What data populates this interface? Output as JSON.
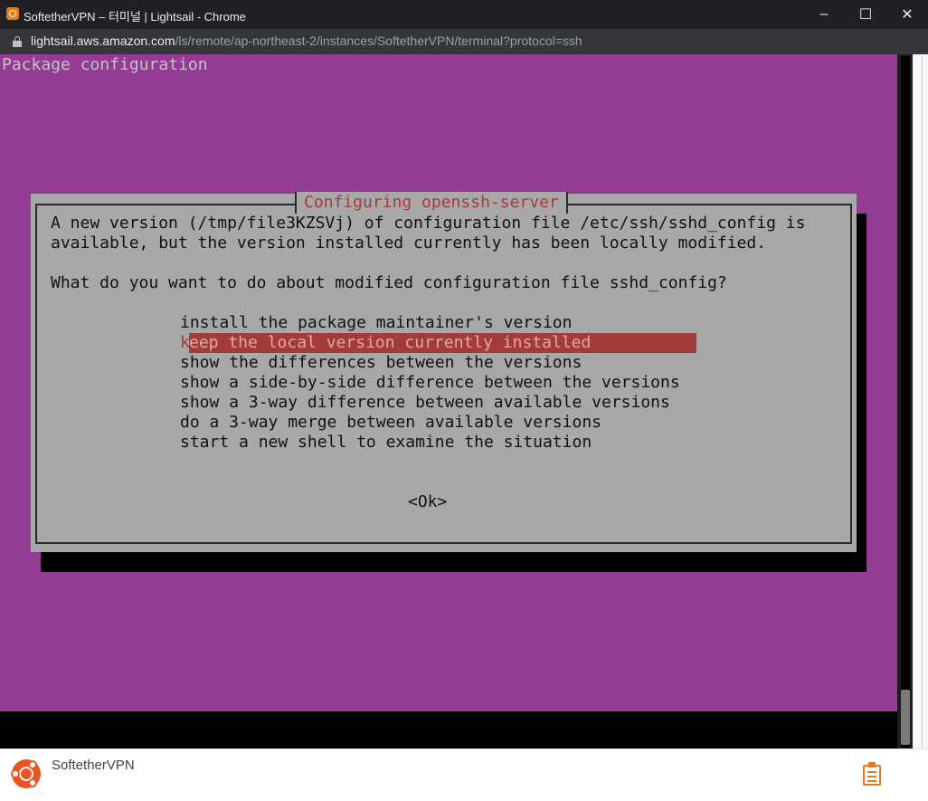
{
  "window": {
    "title": "SoftetherVPN – 터미널 | Lightsail - Chrome",
    "minimize": "–",
    "maximize": "☐",
    "close": "✕"
  },
  "address": {
    "host": "lightsail.aws.amazon.com",
    "path": "/ls/remote/ap-northeast-2/instances/SoftetherVPN/terminal?protocol=ssh"
  },
  "terminal": {
    "screen_title": "Package configuration",
    "dialog": {
      "title": "Configuring openssh-server",
      "message_line1": "A new version (/tmp/file3KZSVj) of configuration file /etc/ssh/sshd_config is",
      "message_line2": "available, but the version installed currently has been locally modified.",
      "question": "What do you want to do about modified configuration file sshd_config?",
      "options": [
        "install the package maintainer's version",
        "keep the local version currently installed",
        "show the differences between the versions",
        "show a side-by-side difference between the versions",
        "show a 3-way difference between available versions",
        "do a 3-way merge between available versions",
        "start a new shell to examine the situation"
      ],
      "selected_option_first_char": "k",
      "selected_option_rest": "eep the local version currently installed",
      "ok_label": "<Ok>"
    }
  },
  "footer": {
    "instance_name": "SoftetherVPN"
  },
  "colors": {
    "terminal_bg": "#943b94",
    "dialog_bg": "#a8a8a8",
    "highlight": "#a33b3b",
    "accent": "#e8791e",
    "ubuntu": "#e95420"
  }
}
